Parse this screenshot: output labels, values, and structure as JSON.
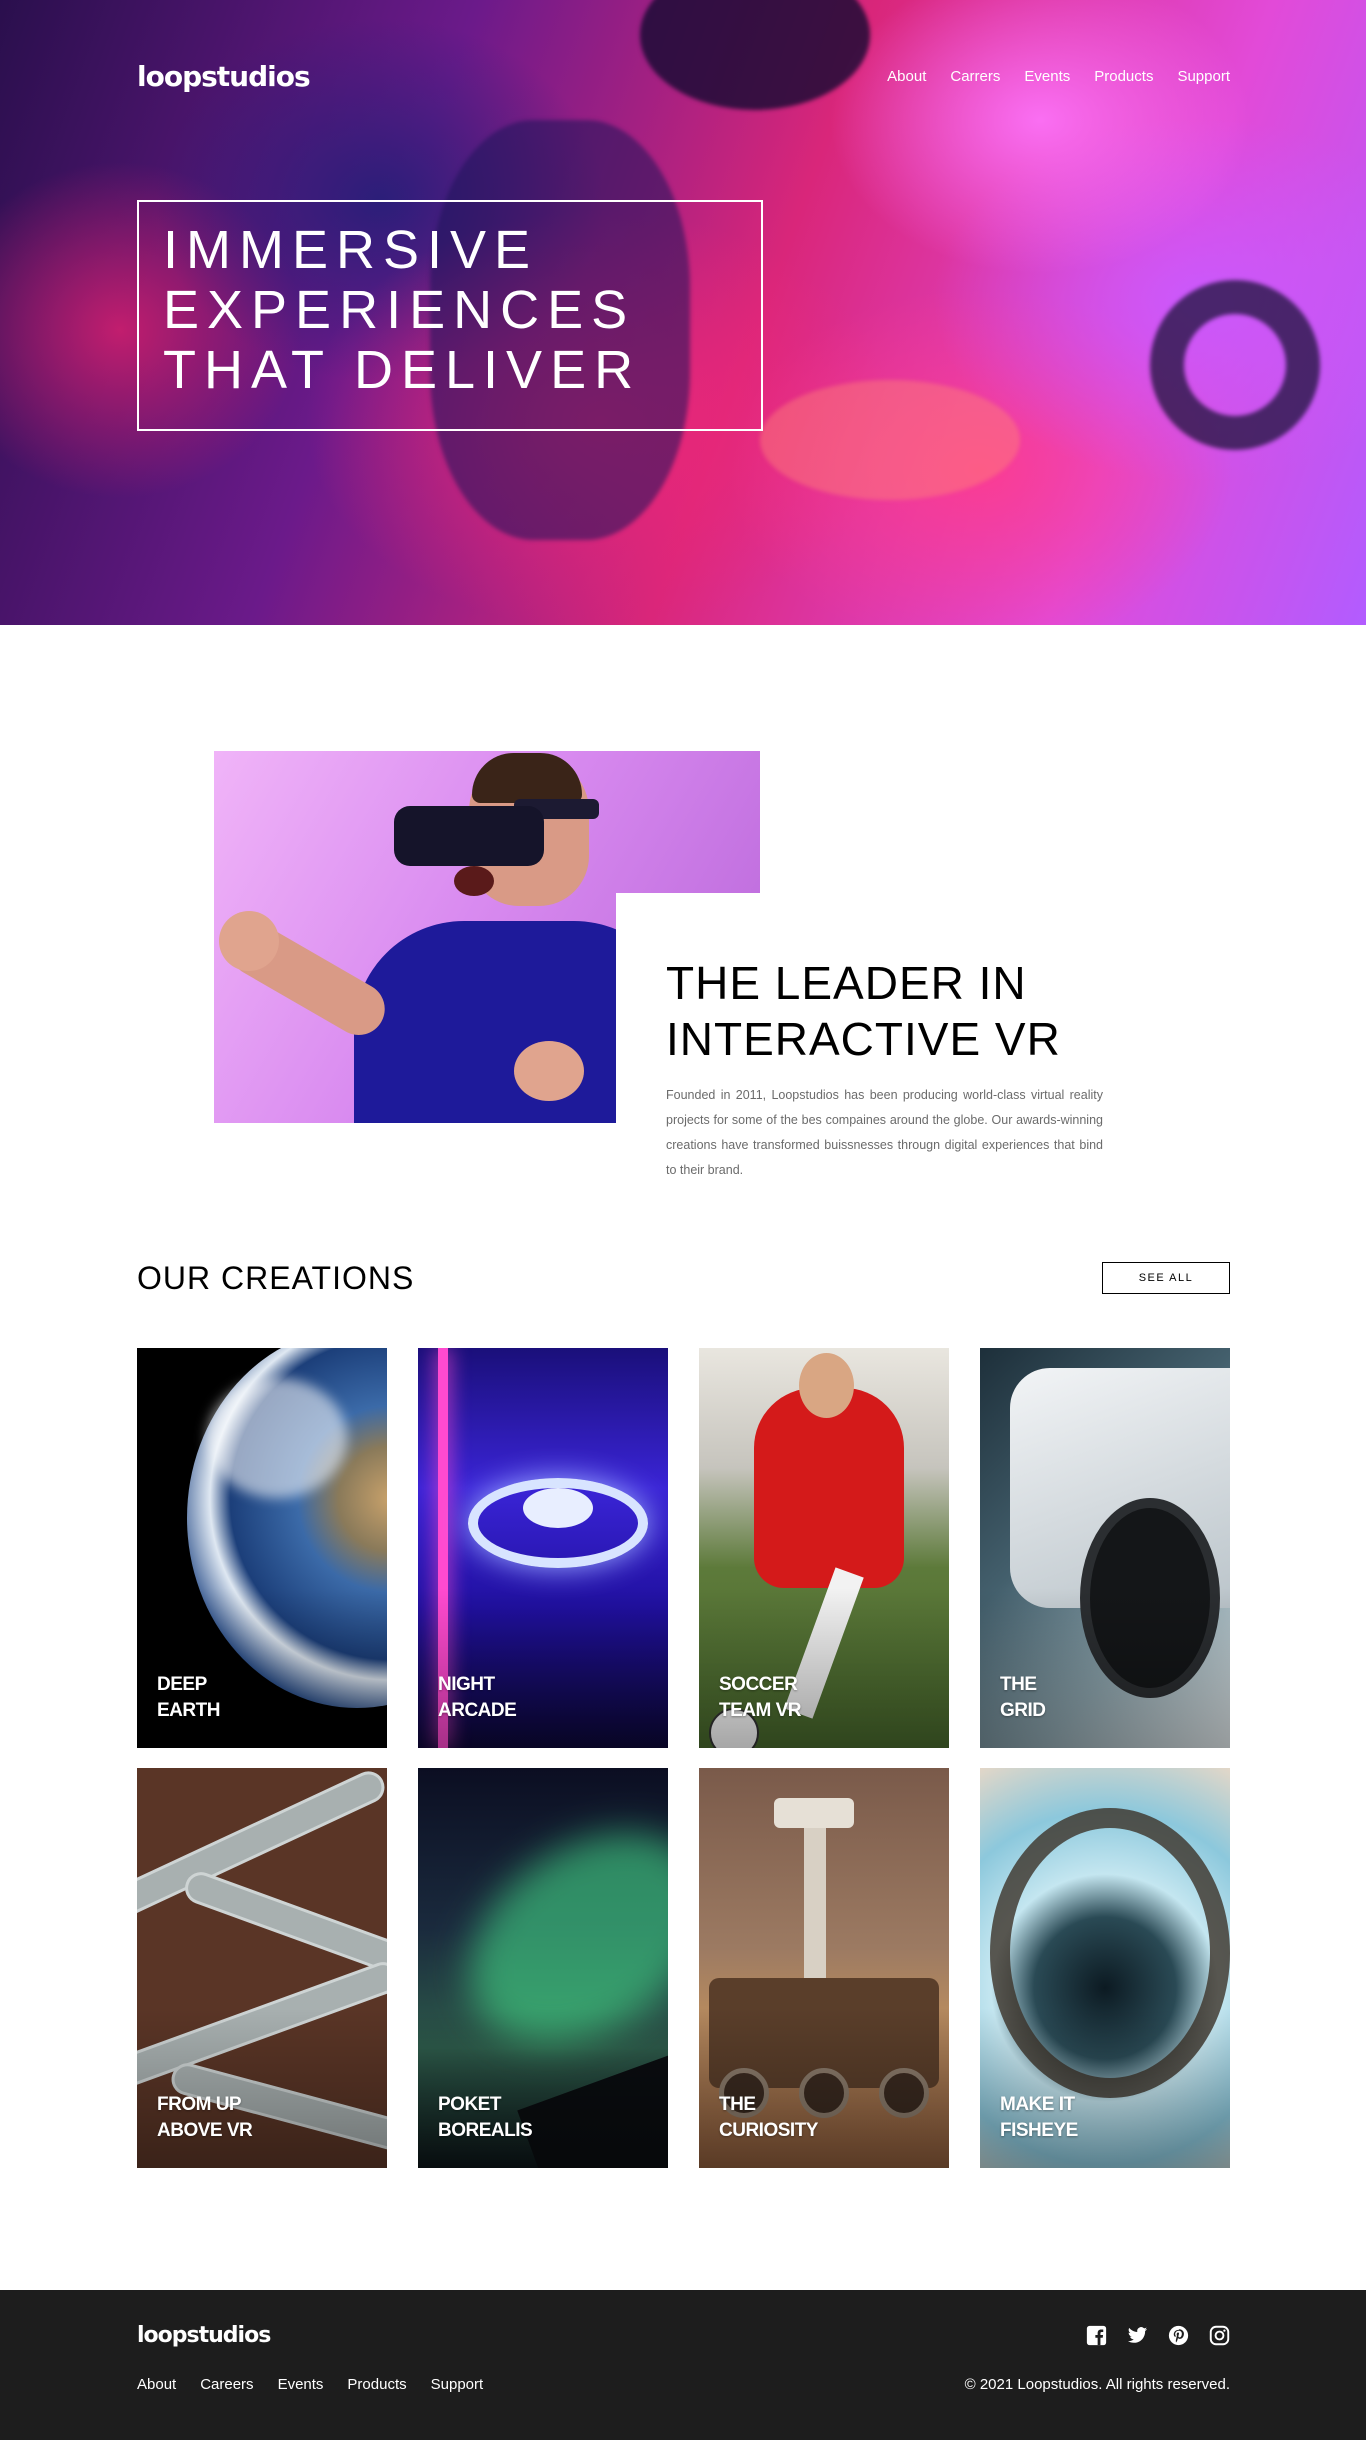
{
  "brand": {
    "logo": "loopstudios"
  },
  "nav": {
    "items": [
      {
        "label": "About"
      },
      {
        "label": "Carrers"
      },
      {
        "label": "Events"
      },
      {
        "label": "Products"
      },
      {
        "label": "Support"
      }
    ]
  },
  "hero": {
    "lines": [
      "Immersive",
      "experiences",
      "that deliver"
    ]
  },
  "intro": {
    "title_lines": [
      "The leader in",
      "interactive VR"
    ],
    "text": "Founded in 2011, Loopstudios has been producing world-class virtual reality projects for some of the bes compaines around the globe. Our awards-winning creations have transformed buissnesses througn digital experiences that bind to their brand."
  },
  "creations": {
    "title": "Our creations",
    "see_all": "See all",
    "cards": [
      {
        "label_lines": [
          "Deep",
          "Earth"
        ]
      },
      {
        "label_lines": [
          "Night",
          "Arcade"
        ]
      },
      {
        "label_lines": [
          "Soccer",
          "Team VR"
        ]
      },
      {
        "label_lines": [
          "The",
          "Grid"
        ]
      },
      {
        "label_lines": [
          "From up",
          "above VR"
        ]
      },
      {
        "label_lines": [
          "Poket",
          "borealis"
        ]
      },
      {
        "label_lines": [
          "The",
          "curiosity"
        ]
      },
      {
        "label_lines": [
          "Make it",
          "fisheye"
        ]
      }
    ]
  },
  "footer": {
    "logo": "loopstudios",
    "links": [
      {
        "label": "About"
      },
      {
        "label": "Careers"
      },
      {
        "label": "Events"
      },
      {
        "label": "Products"
      },
      {
        "label": "Support"
      }
    ],
    "social_icons": [
      "facebook-icon",
      "twitter-icon",
      "pinterest-icon",
      "instagram-icon"
    ],
    "copyright": "© 2021 Loopstudios. All rights reserved."
  }
}
